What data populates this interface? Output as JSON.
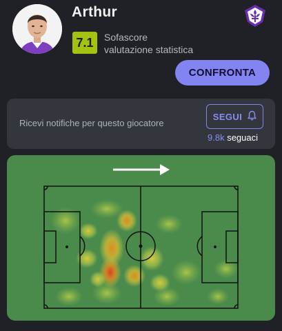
{
  "player": {
    "name": "Arthur",
    "photo_icon": "player-avatar",
    "club_icon": "fiorentina-crest-icon"
  },
  "rating": {
    "value": "7.1",
    "provider": "Sofascore",
    "caption": "valutazione statistica",
    "color": "#a3c40f"
  },
  "actions": {
    "compare_label": "CONFRONTA",
    "accent_color": "#8384f2"
  },
  "notifications": {
    "text": "Ricevi notifiche per questo giocatore",
    "follow_label": "SEGUI",
    "follow_icon": "bell-icon",
    "followers_count": "9.8k",
    "followers_label": "seguaci"
  },
  "heatmap": {
    "direction_icon": "arrow-right-icon",
    "pitch_color": "#4a8a4b"
  }
}
